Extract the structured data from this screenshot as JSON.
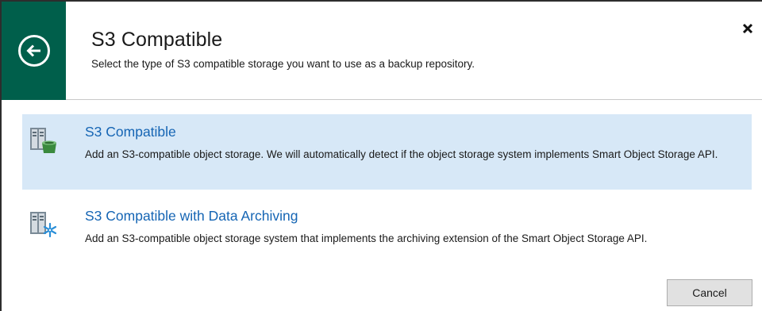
{
  "header": {
    "title": "S3 Compatible",
    "subtitle": "Select the type of S3 compatible storage you want to use as a backup repository.",
    "back_icon": "arrow-left-circle-icon",
    "close_icon": "close-icon",
    "accent_color": "#005f4b"
  },
  "options": [
    {
      "title": "S3 Compatible",
      "description": "Add an S3-compatible object storage. We will automatically detect if the object storage system implements Smart Object Storage API.",
      "icon": "s3-storage-bucket-icon",
      "selected": true
    },
    {
      "title": "S3 Compatible with Data Archiving",
      "description": "Add an S3-compatible object storage system that implements the archiving extension of the Smart Object Storage API.",
      "icon": "s3-storage-archive-icon",
      "selected": false
    }
  ],
  "footer": {
    "cancel_label": "Cancel"
  },
  "colors": {
    "selection_bg": "#d7e8f7",
    "link_text": "#1565b4"
  }
}
